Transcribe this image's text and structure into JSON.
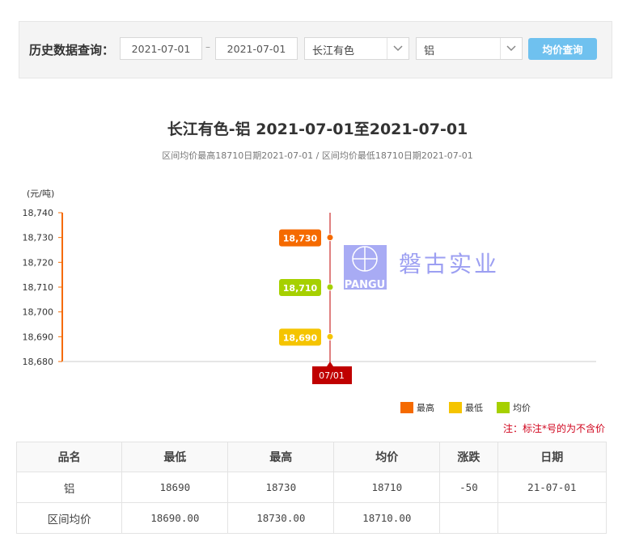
{
  "query": {
    "label": "历史数据查询：",
    "start_date": "2021-07-01",
    "separator": "–",
    "end_date": "2021-07-01",
    "market": "长江有色",
    "metal": "铝",
    "button_label": "均价查询"
  },
  "chart": {
    "title": "长江有色-铝 2021-07-01至2021-07-01",
    "subtitle": "区间均价最高18710日期2021-07-01 / 区间均价最低18710日期2021-07-01",
    "watermark_text": "磐古实业",
    "watermark_logo_text": "PANGU"
  },
  "chart_data": {
    "type": "scatter",
    "ylabel": "(元/吨)",
    "ylim": [
      18680,
      18740
    ],
    "yticks": [
      "18,740",
      "18,730",
      "18,720",
      "18,710",
      "18,700",
      "18,690",
      "18,680"
    ],
    "x": [
      "07/01"
    ],
    "legend_position": "bottom-right",
    "series": [
      {
        "name": "最高",
        "color": "#f56a00",
        "values": [
          18730
        ],
        "label": "18,730"
      },
      {
        "name": "最低",
        "color": "#f5c400",
        "values": [
          18690
        ],
        "label": "18,690"
      },
      {
        "name": "均价",
        "color": "#a6d000",
        "values": [
          18710
        ],
        "label": "18,710"
      }
    ]
  },
  "note": "注：标注*号的为不含价",
  "table": {
    "headers": [
      "品名",
      "最低",
      "最高",
      "均价",
      "涨跌",
      "日期"
    ],
    "rows": [
      [
        "铝",
        "18690",
        "18730",
        "18710",
        "-50",
        "21-07-01"
      ],
      [
        "区间均价",
        "18690.00",
        "18730.00",
        "18710.00",
        "",
        ""
      ]
    ]
  }
}
